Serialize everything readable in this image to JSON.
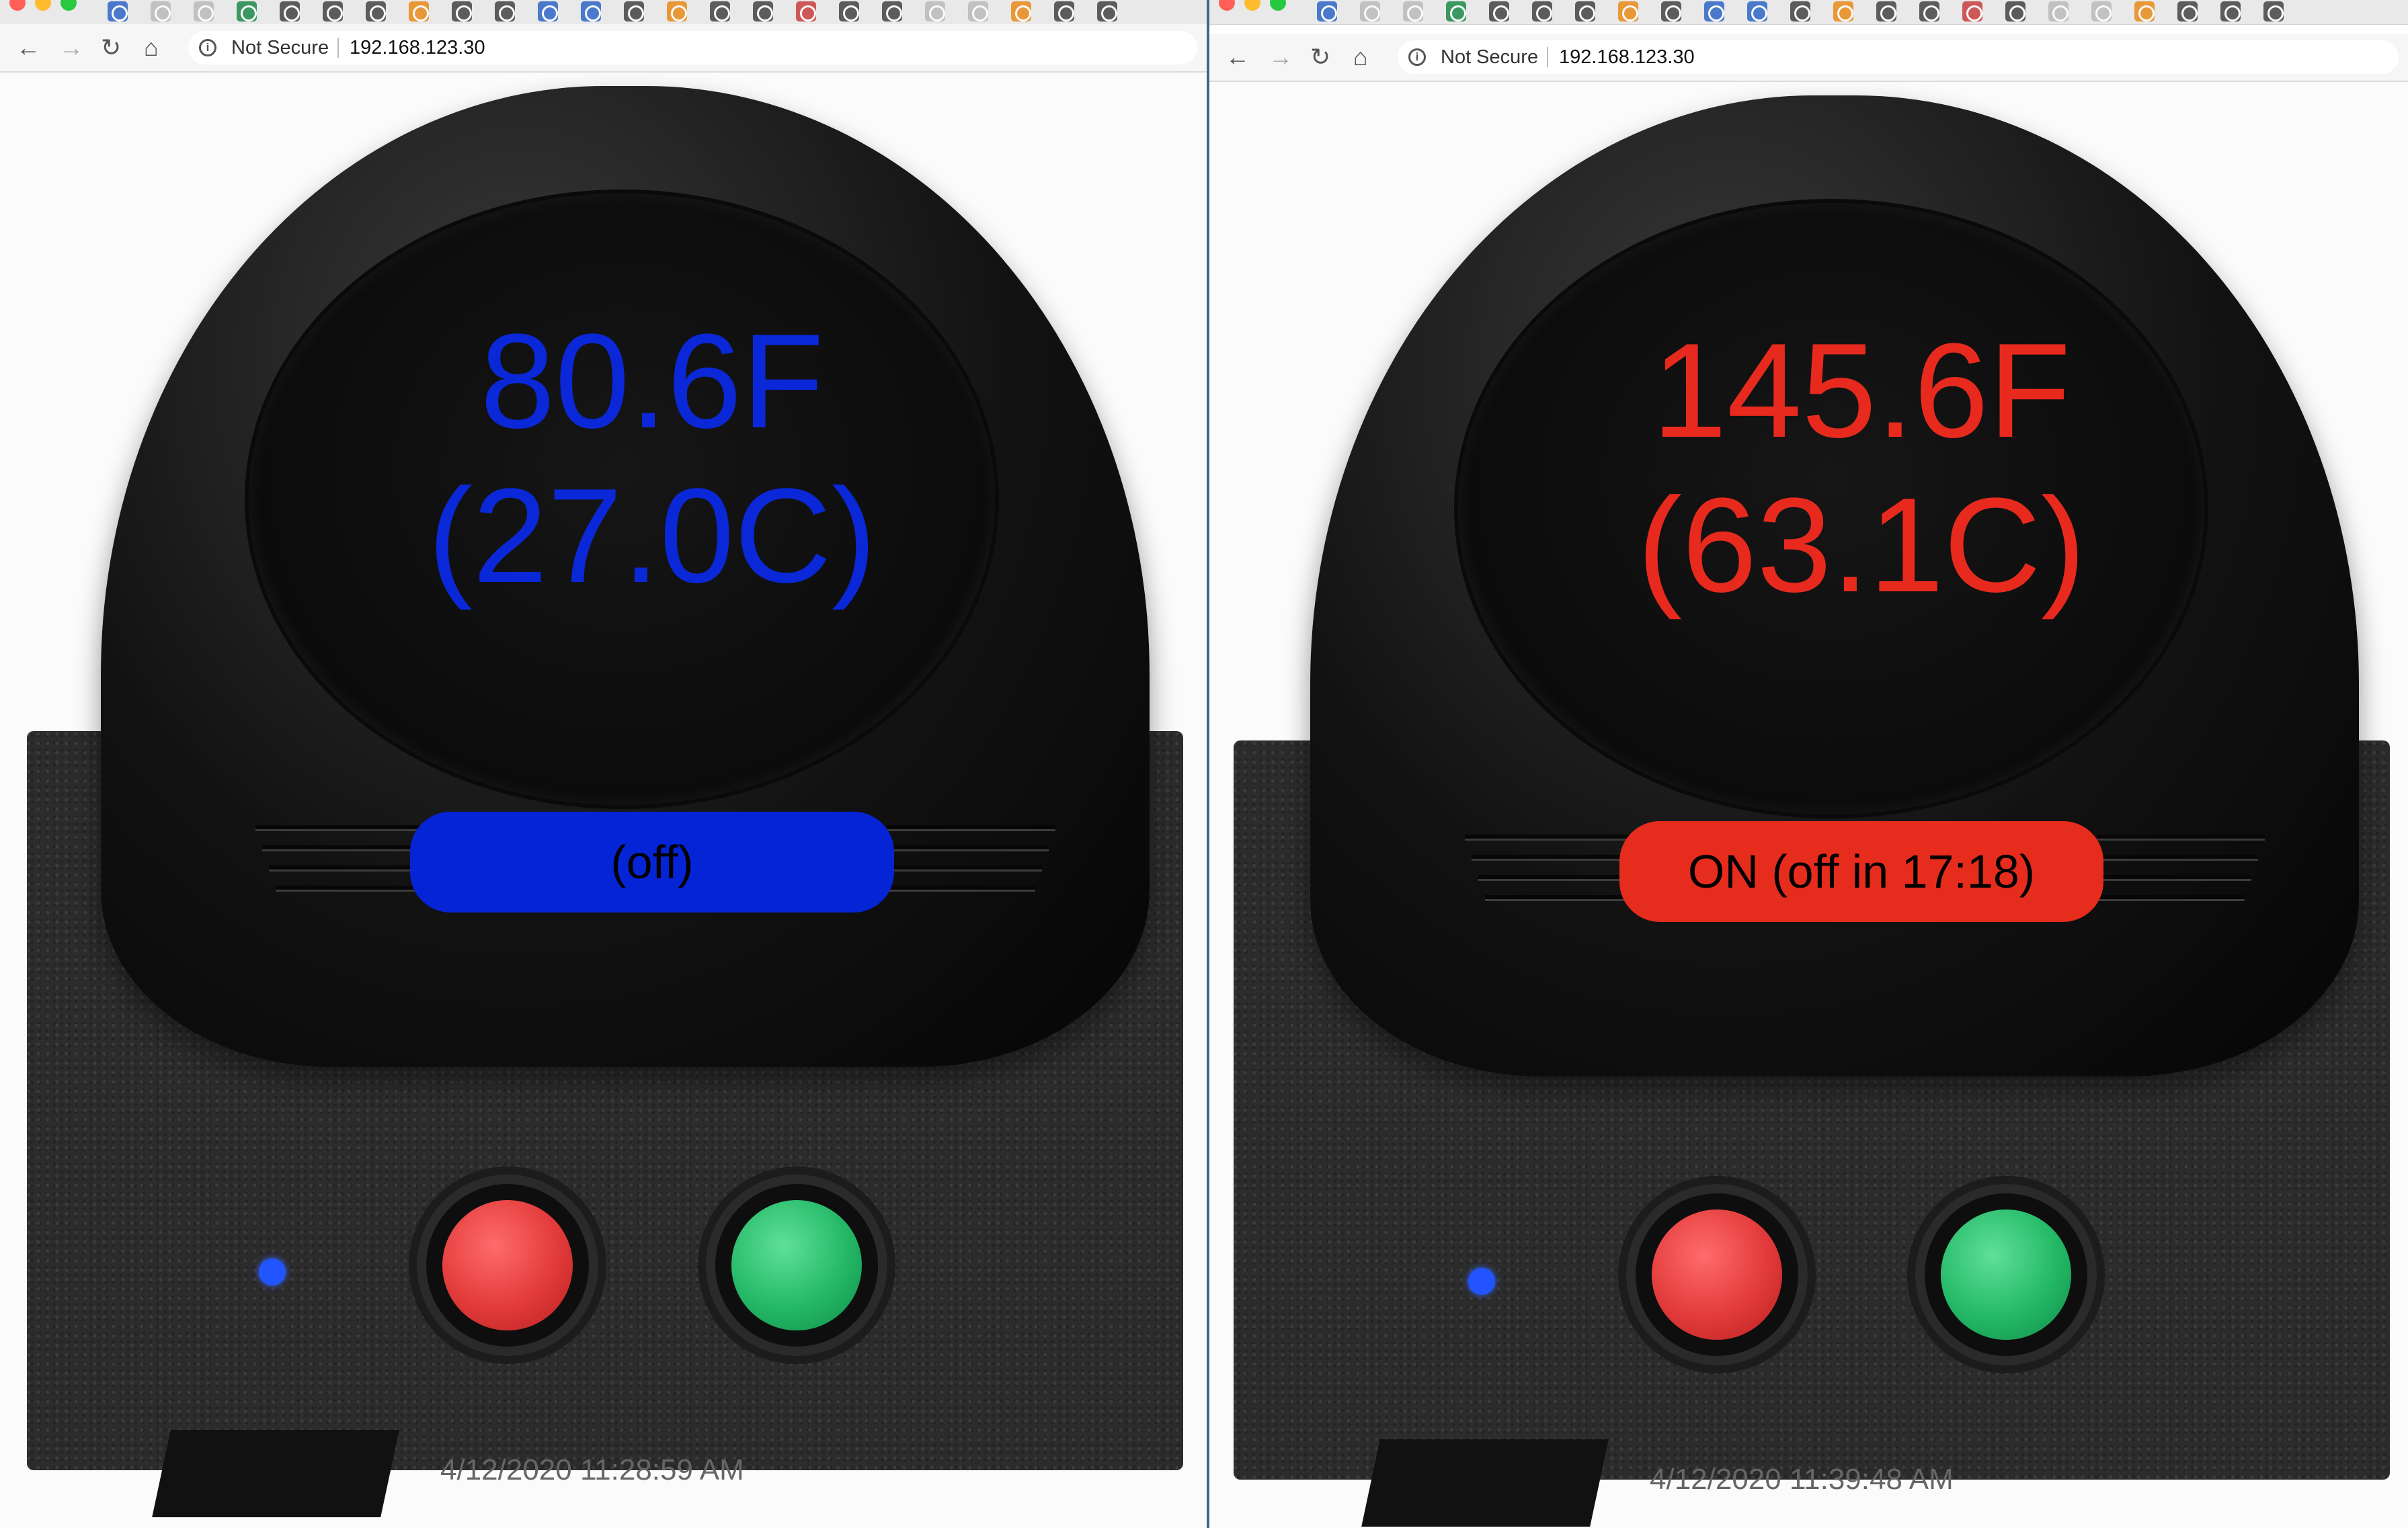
{
  "left": {
    "security_label": "Not Secure",
    "url": "192.168.123.30",
    "temp_f": "80.6F",
    "temp_c": "(27.0C)",
    "status": "(off)",
    "timestamp": "4/12/2020 11:28:59 AM",
    "accent": "#0a28d8",
    "pill_color": "#0524d6"
  },
  "right": {
    "security_label": "Not Secure",
    "url": "192.168.123.30",
    "temp_f": "145.6F",
    "temp_c": "(63.1C)",
    "status": "ON (off in 17:18)",
    "timestamp": "4/12/2020 11:39:48 AM",
    "accent": "#e82a1e",
    "pill_color": "#e62c1c"
  },
  "chrome": {
    "back_icon": "arrow-left-icon",
    "forward_icon": "arrow-right-icon",
    "reload_icon": "reload-icon",
    "home_icon": "home-icon",
    "info_icon": "info-icon"
  }
}
